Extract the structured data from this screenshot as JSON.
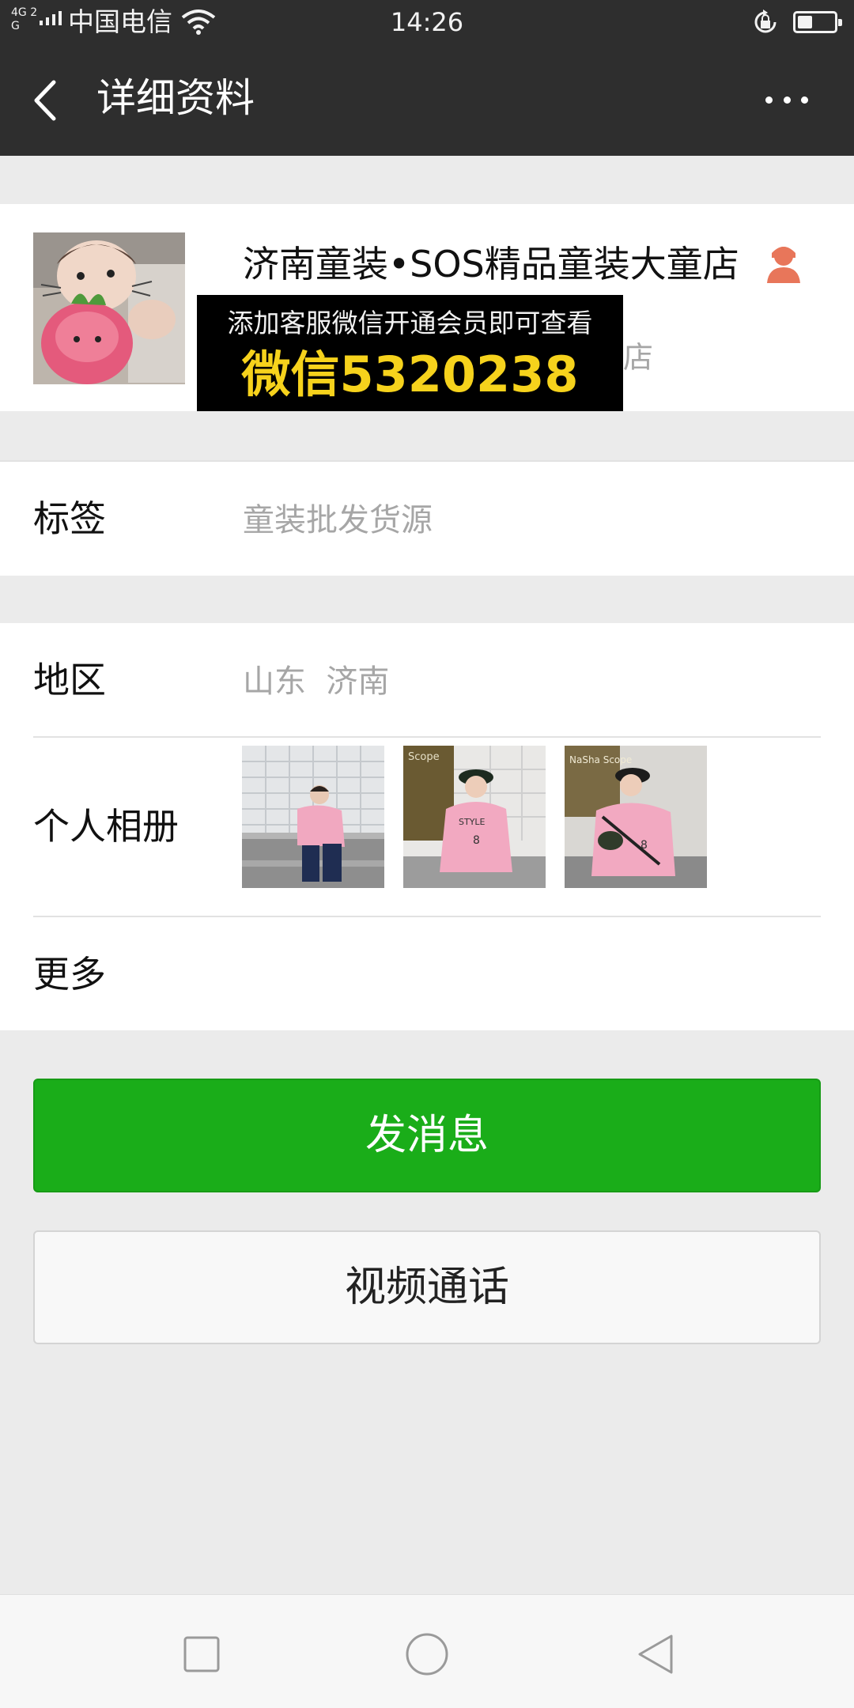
{
  "status_bar": {
    "network": "4G 2G",
    "carrier": "中国电信",
    "time": "14:26",
    "battery_level": 0.4
  },
  "nav": {
    "title": "详细资料"
  },
  "profile": {
    "name": "济南童装•SOS精品童装大童店",
    "partial_text": "店",
    "promo_line1": "添加客服微信开通会员即可查看",
    "promo_line2": "微信5320238"
  },
  "tag_row": {
    "label": "标签",
    "value": "童装批发货源"
  },
  "region_row": {
    "label": "地区",
    "value": "山东  济南"
  },
  "album_row": {
    "label": "个人相册",
    "photos": [
      {
        "sign_text": ""
      },
      {
        "sign_text": "Scope"
      },
      {
        "sign_text": "NaSha Scope"
      }
    ]
  },
  "more_row": {
    "label": "更多"
  },
  "buttons": {
    "send_message": "发消息",
    "video_call": "视频通话"
  },
  "colors": {
    "bar_bg": "#2e2e2e",
    "primary_green": "#1aad19",
    "promo_yellow": "#f6d21c",
    "star_orange": "#e8765a",
    "page_bg": "#ebebeb"
  },
  "icons": {
    "back": "chevron-left-icon",
    "more": "more-dots-icon",
    "star_friend": "star-friend-icon",
    "wifi": "wifi-icon",
    "rotation_lock": "rotation-lock-icon",
    "battery": "battery-icon",
    "nav_square": "recent-apps-icon",
    "nav_circle": "home-icon",
    "nav_triangle": "back-triangle-icon"
  }
}
